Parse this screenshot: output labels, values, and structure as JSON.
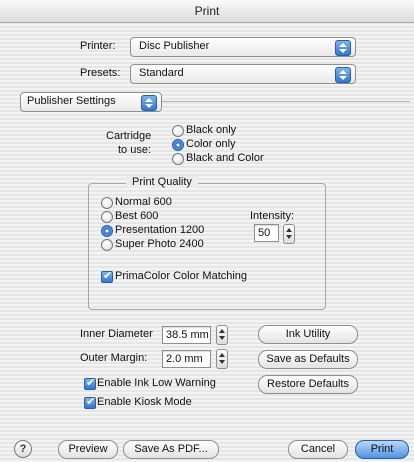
{
  "window": {
    "title": "Print"
  },
  "printer": {
    "label": "Printer:",
    "value": "Disc Publisher"
  },
  "presets": {
    "label": "Presets:",
    "value": "Standard"
  },
  "panel": {
    "value": "Publisher Settings"
  },
  "cartridge": {
    "label_line1": "Cartridge",
    "label_line2": "to use:",
    "options": [
      "Black only",
      "Color only",
      "Black and Color"
    ],
    "selected": "Color only"
  },
  "print_quality": {
    "title": "Print Quality",
    "options": [
      "Normal 600",
      "Best 600",
      "Presentation 1200",
      "Super Photo 2400"
    ],
    "selected": "Presentation 1200",
    "intensity_label": "Intensity:",
    "intensity_value": "50",
    "primacolor_label": "PrimaColor Color Matching",
    "primacolor_checked": true
  },
  "inner_diameter": {
    "label": "Inner Diameter",
    "value": "38.5 mm"
  },
  "outer_margin": {
    "label": "Outer Margin:",
    "value": "2.0 mm"
  },
  "checks": {
    "ink_low": {
      "label": "Enable Ink Low Warning",
      "checked": true
    },
    "kiosk": {
      "label": "Enable Kiosk Mode",
      "checked": true
    }
  },
  "buttons": {
    "ink_utility": "Ink Utility",
    "save_defaults": "Save as Defaults",
    "restore_defaults": "Restore Defaults",
    "help": "?",
    "preview": "Preview",
    "save_pdf": "Save As PDF...",
    "cancel": "Cancel",
    "print": "Print"
  },
  "colors": {
    "accent": "#2f78d0",
    "default_button": "#4f95e2"
  }
}
